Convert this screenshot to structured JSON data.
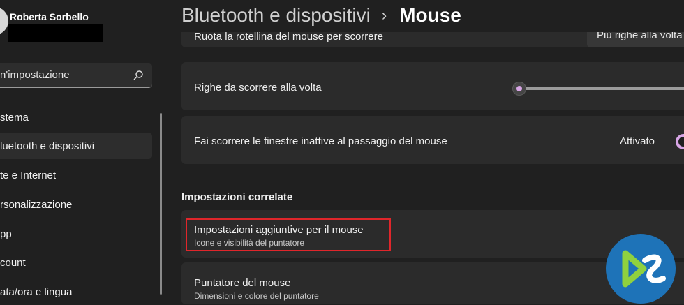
{
  "user": {
    "name": "Roberta Sorbello"
  },
  "search": {
    "value": "n'impostazione"
  },
  "sidebar": {
    "items": [
      {
        "label": "stema"
      },
      {
        "label": "luetooth e dispositivi"
      },
      {
        "label": "te e Internet"
      },
      {
        "label": "rsonalizzazione"
      },
      {
        "label": "pp"
      },
      {
        "label": "count"
      },
      {
        "label": "ata/ora e lingua"
      }
    ],
    "selected_index": 1
  },
  "breadcrumb": {
    "parent": "Bluetooth e dispositivi",
    "separator": "›",
    "current": "Mouse"
  },
  "settings": {
    "scroll_wheel": {
      "label": "Ruota la rotellina del mouse per scorrere",
      "value": "Più righe alla volta"
    },
    "lines_to_scroll": {
      "label": "Righe da scorrere alla volta",
      "value_fraction": 0.02
    },
    "inactive_scroll": {
      "label": "Fai scorrere le finestre inattive al passaggio del mouse",
      "state": "Attivato"
    }
  },
  "related": {
    "title": "Impostazioni correlate",
    "additional": {
      "label": "Impostazioni aggiuntive per il mouse",
      "sub": "Icone e visibilità del puntatore"
    },
    "pointer": {
      "label": "Puntatore del mouse",
      "sub": "Dimensioni e colore del puntatore"
    }
  },
  "colors": {
    "background": "#202020",
    "card": "#2b2b2b",
    "accent": "#d8a6e6",
    "highlight": "#e0262b"
  },
  "icons": {
    "search": "search-icon",
    "watermark": "logo-watermark"
  }
}
